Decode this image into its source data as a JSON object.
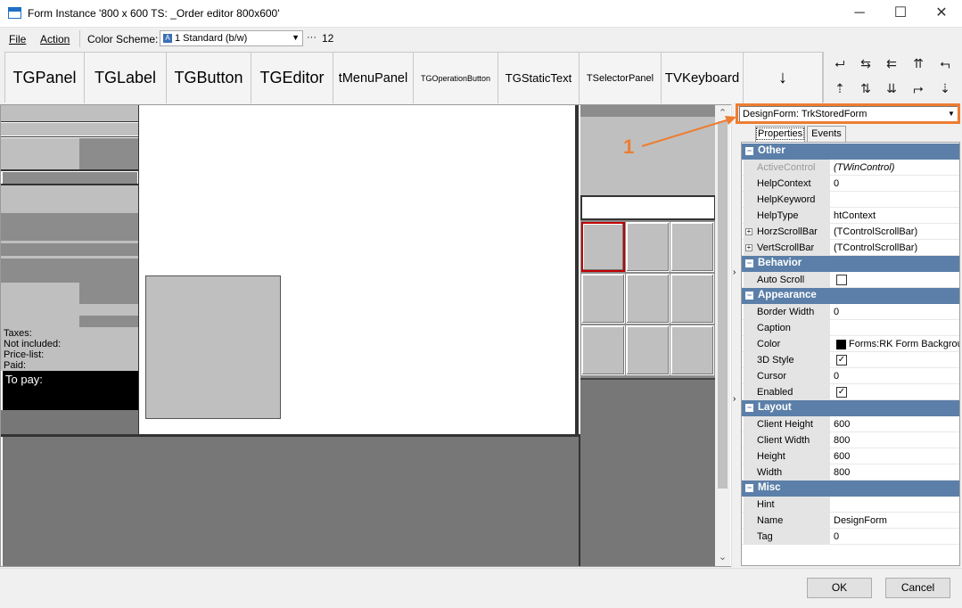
{
  "window": {
    "title": "Form Instance '800 x 600 TS: _Order editor 800x600'",
    "controls": {
      "minimize": "─",
      "maximize": "☐",
      "close": "✕"
    }
  },
  "menu": {
    "file": "File",
    "action": "Action",
    "color_scheme_label": "Color Scheme:",
    "color_scheme_value": "1 Standard (b/w)",
    "color_scheme_icon": "A",
    "dots": "···",
    "count": "12"
  },
  "toolbar": {
    "buttons": [
      "TGPanel",
      "TGLabel",
      "TGButton",
      "TGEditor",
      "tMenuPanel",
      "TGOperationButton",
      "TGStaticText",
      "TSelectorPanel",
      "TVKeyboard",
      "↓"
    ]
  },
  "align_icons": [
    "align-left-icon",
    "align-hcenter-icon",
    "align-right-icon",
    "align-top-icon",
    "align-vcenter-icon",
    "align-bottom-icon",
    "space-h-icon",
    "space-v-icon",
    "same-width-icon",
    "same-height-icon"
  ],
  "canvas": {
    "info_labels": [
      "Taxes:",
      "Not included:",
      "Price-list:",
      "Paid:"
    ],
    "to_pay": "To pay:"
  },
  "inspector": {
    "form_select": "DesignForm: TrkStoredForm",
    "callout": "1",
    "tabs": {
      "properties": "Properties",
      "events": "Events"
    },
    "sections": [
      {
        "name": "Other",
        "props": [
          {
            "name": "ActiveControl",
            "value": "(TWinControl)",
            "dim": true,
            "italic": true
          },
          {
            "name": "HelpContext",
            "value": "0"
          },
          {
            "name": "HelpKeyword",
            "value": ""
          },
          {
            "name": "HelpType",
            "value": "htContext"
          },
          {
            "name": "HorzScrollBar",
            "value": "(TControlScrollBar)",
            "expand": true
          },
          {
            "name": "VertScrollBar",
            "value": "(TControlScrollBar)",
            "expand": true
          }
        ]
      },
      {
        "name": "Behavior",
        "props": [
          {
            "name": "Auto Scroll",
            "value": "",
            "check": false
          }
        ]
      },
      {
        "name": "Appearance",
        "props": [
          {
            "name": "Border Width",
            "value": "0"
          },
          {
            "name": "Caption",
            "value": ""
          },
          {
            "name": "Color",
            "value": "Forms:RK Form Backgrou",
            "swatch": "#000000"
          },
          {
            "name": "3D Style",
            "value": "",
            "check": true
          },
          {
            "name": "Cursor",
            "value": "0"
          },
          {
            "name": "Enabled",
            "value": "",
            "check": true
          }
        ]
      },
      {
        "name": "Layout",
        "props": [
          {
            "name": "Client Height",
            "value": "600"
          },
          {
            "name": "Client Width",
            "value": "800"
          },
          {
            "name": "Height",
            "value": "600"
          },
          {
            "name": "Width",
            "value": "800"
          }
        ]
      },
      {
        "name": "Misc",
        "props": [
          {
            "name": "Hint",
            "value": ""
          },
          {
            "name": "Name",
            "value": "DesignForm"
          },
          {
            "name": "Tag",
            "value": "0"
          }
        ]
      }
    ]
  },
  "dialog": {
    "ok": "OK",
    "cancel": "Cancel"
  },
  "colors": {
    "accent": "#ed7d31",
    "section": "#5b7fa8"
  }
}
